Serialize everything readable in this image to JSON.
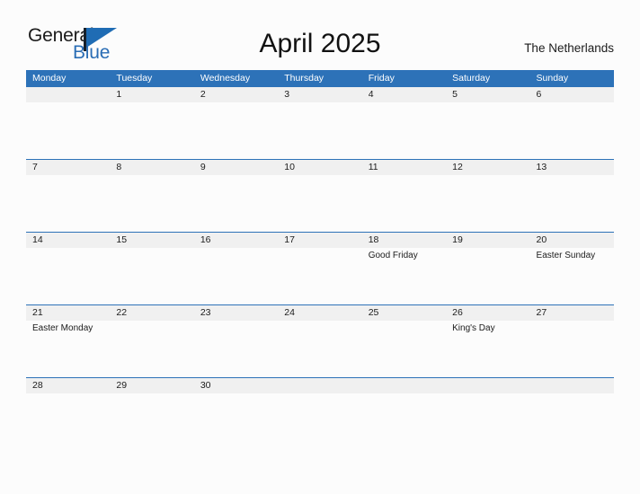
{
  "brand": {
    "name_part1": "General",
    "name_part2": "Blue",
    "mark": "triangle-logo-icon",
    "accent_color": "#2a6db5"
  },
  "header": {
    "title": "April 2025",
    "region": "The Netherlands"
  },
  "calendar": {
    "header_bg": "#2d72b8",
    "row_band_bg": "#f0f0f0",
    "weekdays": [
      "Monday",
      "Tuesday",
      "Wednesday",
      "Thursday",
      "Friday",
      "Saturday",
      "Sunday"
    ],
    "weeks": [
      [
        {
          "day": "",
          "event": ""
        },
        {
          "day": "1",
          "event": ""
        },
        {
          "day": "2",
          "event": ""
        },
        {
          "day": "3",
          "event": ""
        },
        {
          "day": "4",
          "event": ""
        },
        {
          "day": "5",
          "event": ""
        },
        {
          "day": "6",
          "event": ""
        }
      ],
      [
        {
          "day": "7",
          "event": ""
        },
        {
          "day": "8",
          "event": ""
        },
        {
          "day": "9",
          "event": ""
        },
        {
          "day": "10",
          "event": ""
        },
        {
          "day": "11",
          "event": ""
        },
        {
          "day": "12",
          "event": ""
        },
        {
          "day": "13",
          "event": ""
        }
      ],
      [
        {
          "day": "14",
          "event": ""
        },
        {
          "day": "15",
          "event": ""
        },
        {
          "day": "16",
          "event": ""
        },
        {
          "day": "17",
          "event": ""
        },
        {
          "day": "18",
          "event": "Good Friday"
        },
        {
          "day": "19",
          "event": ""
        },
        {
          "day": "20",
          "event": "Easter Sunday"
        }
      ],
      [
        {
          "day": "21",
          "event": "Easter Monday"
        },
        {
          "day": "22",
          "event": ""
        },
        {
          "day": "23",
          "event": ""
        },
        {
          "day": "24",
          "event": ""
        },
        {
          "day": "25",
          "event": ""
        },
        {
          "day": "26",
          "event": "King's Day"
        },
        {
          "day": "27",
          "event": ""
        }
      ],
      [
        {
          "day": "28",
          "event": ""
        },
        {
          "day": "29",
          "event": ""
        },
        {
          "day": "30",
          "event": ""
        },
        {
          "day": "",
          "event": ""
        },
        {
          "day": "",
          "event": ""
        },
        {
          "day": "",
          "event": ""
        },
        {
          "day": "",
          "event": ""
        }
      ]
    ]
  }
}
